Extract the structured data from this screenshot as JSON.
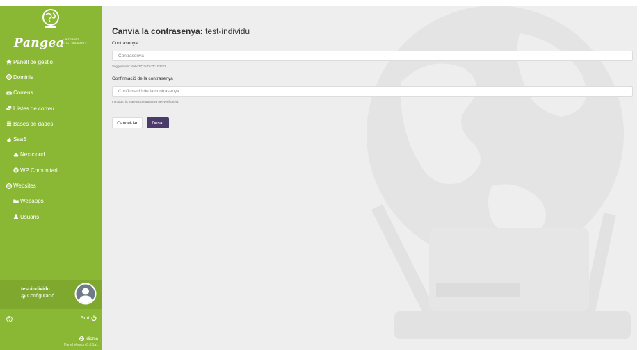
{
  "sidebar": {
    "brand": "Pangea",
    "tagline_line1": "< INTERNET",
    "tagline_line2": "ÈTIC I SOLIDARI >",
    "items": [
      {
        "label": "Panell de gestió",
        "icon": "home-icon"
      },
      {
        "label": "Dominis",
        "icon": "globe-icon"
      },
      {
        "label": "Correus",
        "icon": "envelope-icon"
      },
      {
        "label": "Llistes de correu",
        "icon": "mail-bulk-icon"
      },
      {
        "label": "Bases de dades",
        "icon": "database-icon"
      },
      {
        "label": "SaaS",
        "icon": "fire-icon"
      },
      {
        "label": "Nextcloud",
        "icon": "cloud-icon"
      },
      {
        "label": "WP Comunitari",
        "icon": "wordpress-icon"
      },
      {
        "label": "Websites",
        "icon": "globe-icon"
      },
      {
        "label": "Webapps",
        "icon": "folder-icon"
      },
      {
        "label": "Usuaris",
        "icon": "user-icon"
      }
    ],
    "user": {
      "name": "test-individu",
      "config_label": "Configuració"
    },
    "logout_label": "Surt",
    "language_label": "Idioma",
    "version": "Panel Version 0.0.1a1"
  },
  "main": {
    "title_bold": "Canvia la contrasenya:",
    "title_user": "test-individu",
    "password": {
      "label": "Contrasenya",
      "placeholder": "Contrasenya",
      "suggestion": "Suggeriment: debd7727c7ad7c1bdd22"
    },
    "confirm": {
      "label": "Confirmació de la contrasenya",
      "placeholder": "Confirmació de la contrasenya",
      "hint": "Introduïu la mateixa contrasenya per verificar-la."
    },
    "cancel_label": "Cancel·lar",
    "save_label": "Desar"
  },
  "colors": {
    "sidebar": "#8ab835",
    "primary_button": "#4b3b6b",
    "background": "#eeeeee"
  }
}
